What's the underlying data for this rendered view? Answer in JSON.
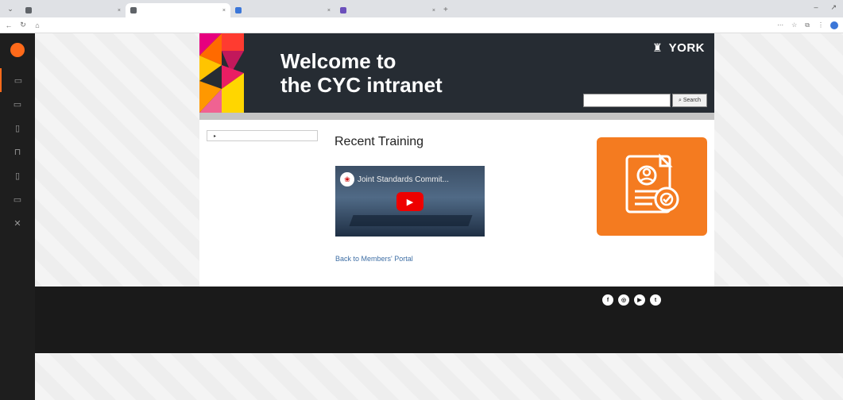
{
  "browser": {
    "tabs": [
      {
        "title": "",
        "fav_color": "#5f6368",
        "active": false
      },
      {
        "title": "",
        "fav_color": "#5f6368",
        "active": true
      },
      {
        "title": "",
        "fav_color": "#3b76d8",
        "active": false
      },
      {
        "title": "",
        "fav_color": "#6b4fbb",
        "active": false
      }
    ],
    "url": "",
    "window_controls": [
      "–",
      "↗"
    ]
  },
  "sidebar": {
    "accent": "#ff6a1a",
    "items": [
      "▭",
      "▭",
      "▯",
      "⊓",
      "▯",
      "▭",
      "✕"
    ]
  },
  "header": {
    "title_line1": "Welcome to",
    "title_line2": "the CYC intranet",
    "org_name": "YORK",
    "search_button": "Search"
  },
  "content": {
    "leftnav_item": "",
    "page_title": "Recent Training",
    "video_title": "Joint Standards Commit...",
    "back_link": "Back to Members' Portal"
  },
  "colors": {
    "header_bg": "#262c33",
    "accent_orange": "#f47b20",
    "footer_bg": "#1a1a1a"
  },
  "footer": {
    "social": [
      "f",
      "◎",
      "▶",
      "t"
    ]
  }
}
